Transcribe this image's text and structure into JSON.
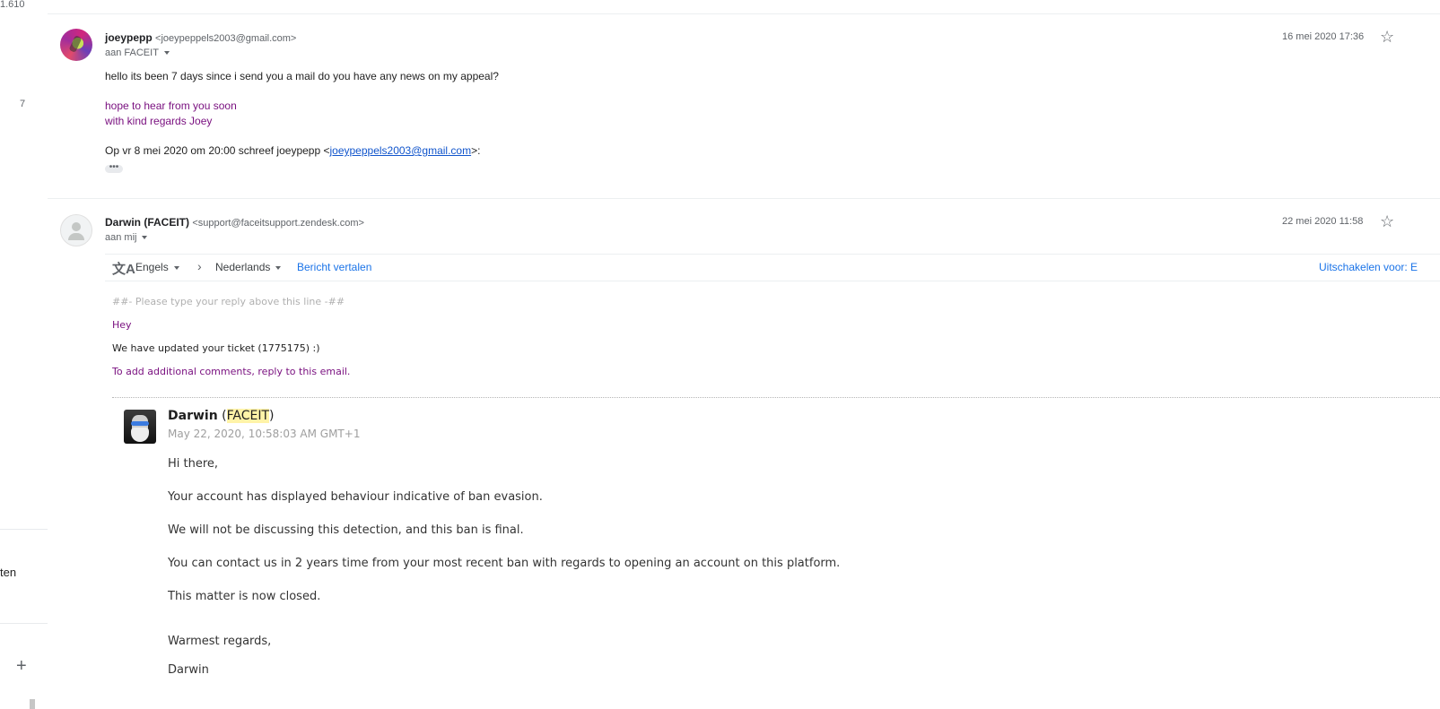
{
  "left_rail": {
    "count": "1.610",
    "badge": "7",
    "label_partial": "ten",
    "add_icon": "+"
  },
  "message1": {
    "sender_name": "joeypepp",
    "sender_email": "<joeypeppels2003@gmail.com>",
    "recipient": "aan FACEIT",
    "date": "16 mei 2020 17:36",
    "line1": "hello its been 7 days since i send you a mail do you have any news on my appeal?",
    "line2": "hope to hear from you soon",
    "line3": "with kind regards Joey",
    "quote_prefix": "Op vr 8 mei 2020 om 20:00 schreef joeypepp <",
    "quote_email": "joeypeppels2003@gmail.com",
    "quote_suffix": ">:",
    "expand_label": "•••"
  },
  "message2": {
    "sender_name": "Darwin (FACEIT)",
    "sender_email": "<support@faceitsupport.zendesk.com>",
    "recipient": "aan mij",
    "date": "22 mei 2020 11:58",
    "translate": {
      "icon": "文A",
      "from_lang": "Engels",
      "arrow": "›",
      "to_lang": "Nederlands",
      "translate_link": "Bericht vertalen",
      "disable_link": "Uitschakelen voor: E"
    },
    "reply_marker": "##- Please type your reply above this line -##",
    "hey": "Hey",
    "updated": "We have updated your ticket (1775175) :)",
    "comments": "To add additional comments, reply to this email.",
    "agent": {
      "name": "Darwin",
      "paren_open": " (",
      "org": "FACEIT",
      "paren_close": ")",
      "timestamp": "May 22, 2020, 10:58:03 AM GMT+1"
    },
    "body": [
      "Hi there,",
      "Your account has displayed behaviour indicative of ban evasion.",
      "We will not be discussing this detection, and this ban is final.",
      "You can contact us in 2 years time from your most recent ban with regards to opening an account on this platform.",
      "This matter is now closed.",
      "Warmest regards,",
      "Darwin"
    ]
  },
  "icons": {
    "star": "☆"
  }
}
